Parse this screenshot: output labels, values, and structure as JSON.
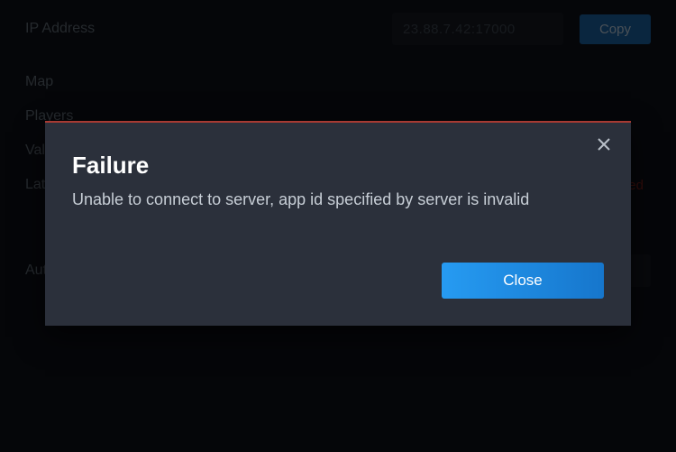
{
  "background": {
    "rows": {
      "ip_address": {
        "label": "IP Address",
        "value": "23.88.7.42:17000",
        "copy_label": "Copy"
      },
      "map": {
        "label": "Map"
      },
      "players": {
        "label": "Players"
      },
      "vac": {
        "label": "Valve Anti-Cheat"
      },
      "latency": {
        "label": "Latency",
        "status": "Not responded"
      },
      "auto": {
        "label": "Auto-join"
      }
    }
  },
  "modal": {
    "title": "Failure",
    "message": "Unable to connect to server, app id specified by server is invalid",
    "close_label": "Close"
  }
}
